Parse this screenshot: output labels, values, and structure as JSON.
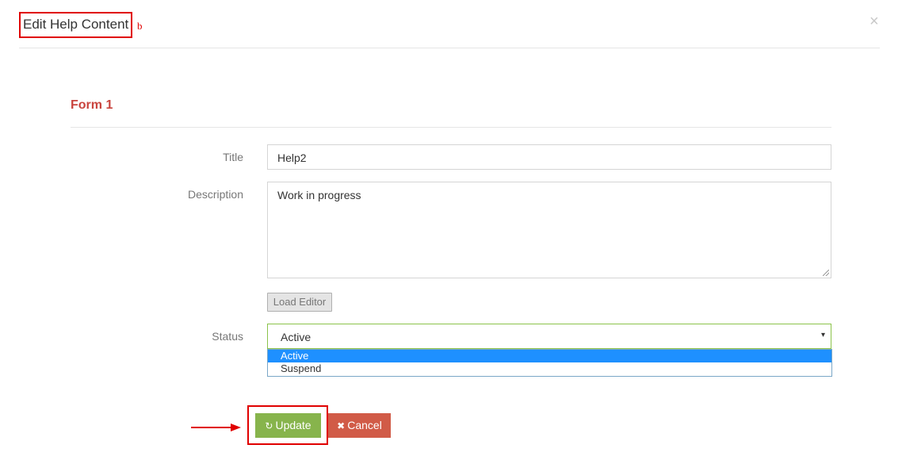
{
  "modal": {
    "title": "Edit Help Content",
    "marker": "b",
    "close_label": "×"
  },
  "form": {
    "section_title": "Form 1",
    "title_label": "Title",
    "title_value": "Help2",
    "description_label": "Description",
    "description_value": "Work in progress",
    "load_editor_label": "Load Editor",
    "status_label": "Status",
    "status_value": "Active",
    "status_caret": "▾",
    "status_options": [
      "Active",
      "Suspend"
    ]
  },
  "actions": {
    "update_icon": "↻",
    "update_label": "Update",
    "cancel_icon": "✖",
    "cancel_label": "Cancel"
  },
  "colors": {
    "annotation": "#e00000",
    "section_title": "#c9443e",
    "update_button": "#87b44c",
    "cancel_button": "#d15b47",
    "selected_option": "#1e90ff"
  }
}
